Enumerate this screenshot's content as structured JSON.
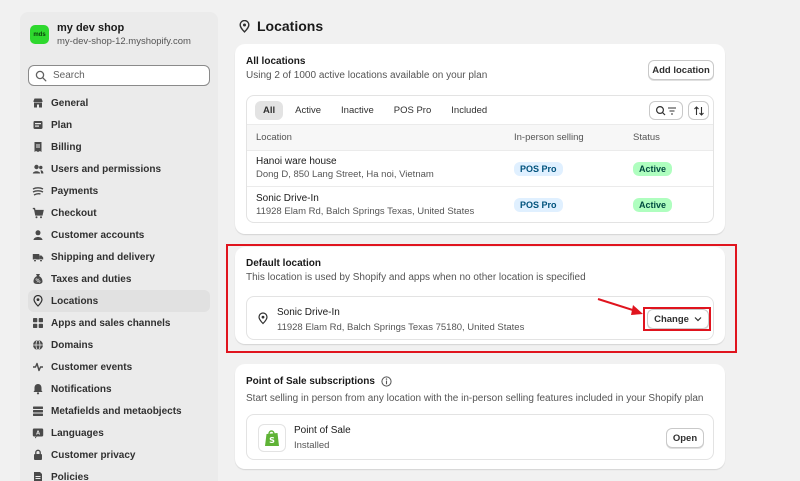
{
  "shop": {
    "logo_text": "mds",
    "name": "my dev shop",
    "url": "my-dev-shop-12.myshopify.com"
  },
  "search": {
    "placeholder": "Search"
  },
  "nav": [
    {
      "label": "General",
      "icon": "store-icon"
    },
    {
      "label": "Plan",
      "icon": "plan-icon"
    },
    {
      "label": "Billing",
      "icon": "billing-icon"
    },
    {
      "label": "Users and permissions",
      "icon": "users-icon"
    },
    {
      "label": "Payments",
      "icon": "payments-icon"
    },
    {
      "label": "Checkout",
      "icon": "cart-icon"
    },
    {
      "label": "Customer accounts",
      "icon": "person-icon"
    },
    {
      "label": "Shipping and delivery",
      "icon": "truck-icon"
    },
    {
      "label": "Taxes and duties",
      "icon": "tax-icon"
    },
    {
      "label": "Locations",
      "icon": "location-icon",
      "active": true
    },
    {
      "label": "Apps and sales channels",
      "icon": "apps-icon"
    },
    {
      "label": "Domains",
      "icon": "globe-icon"
    },
    {
      "label": "Customer events",
      "icon": "events-icon"
    },
    {
      "label": "Notifications",
      "icon": "bell-icon"
    },
    {
      "label": "Metafields and metaobjects",
      "icon": "metafields-icon"
    },
    {
      "label": "Languages",
      "icon": "language-icon"
    },
    {
      "label": "Customer privacy",
      "icon": "lock-icon"
    },
    {
      "label": "Policies",
      "icon": "policies-icon"
    }
  ],
  "page": {
    "title": "Locations"
  },
  "all_locations": {
    "title": "All locations",
    "subtitle": "Using 2 of 1000 active locations available on your plan",
    "add_button": "Add location",
    "tabs": [
      "All",
      "Active",
      "Inactive",
      "POS Pro",
      "Included"
    ],
    "columns": [
      "Location",
      "In-person selling",
      "Status"
    ],
    "rows": [
      {
        "name": "Hanoi ware house",
        "address": "Dong D, 850 Lang Street, Ha noi, Vietnam",
        "selling": "POS Pro",
        "status": "Active"
      },
      {
        "name": "Sonic Drive-In",
        "address": "11928 Elam Rd, Balch Springs Texas, United States",
        "selling": "POS Pro",
        "status": "Active"
      }
    ]
  },
  "default_location": {
    "title": "Default location",
    "subtitle": "This location is used by Shopify and apps when no other location is specified",
    "name": "Sonic Drive-In",
    "address": "11928 Elam Rd, Balch Springs Texas 75180, United States",
    "change_button": "Change"
  },
  "pos": {
    "title": "Point of Sale subscriptions",
    "subtitle": "Start selling in person from any location with the in-person selling features included in your Shopify plan",
    "app_name": "Point of Sale",
    "app_status": "Installed",
    "open_button": "Open"
  },
  "colors": {
    "highlight": "#e0141e",
    "logo_green": "#2ed82e",
    "active_badge": "#affebf",
    "pos_badge": "#e0f0ff"
  }
}
